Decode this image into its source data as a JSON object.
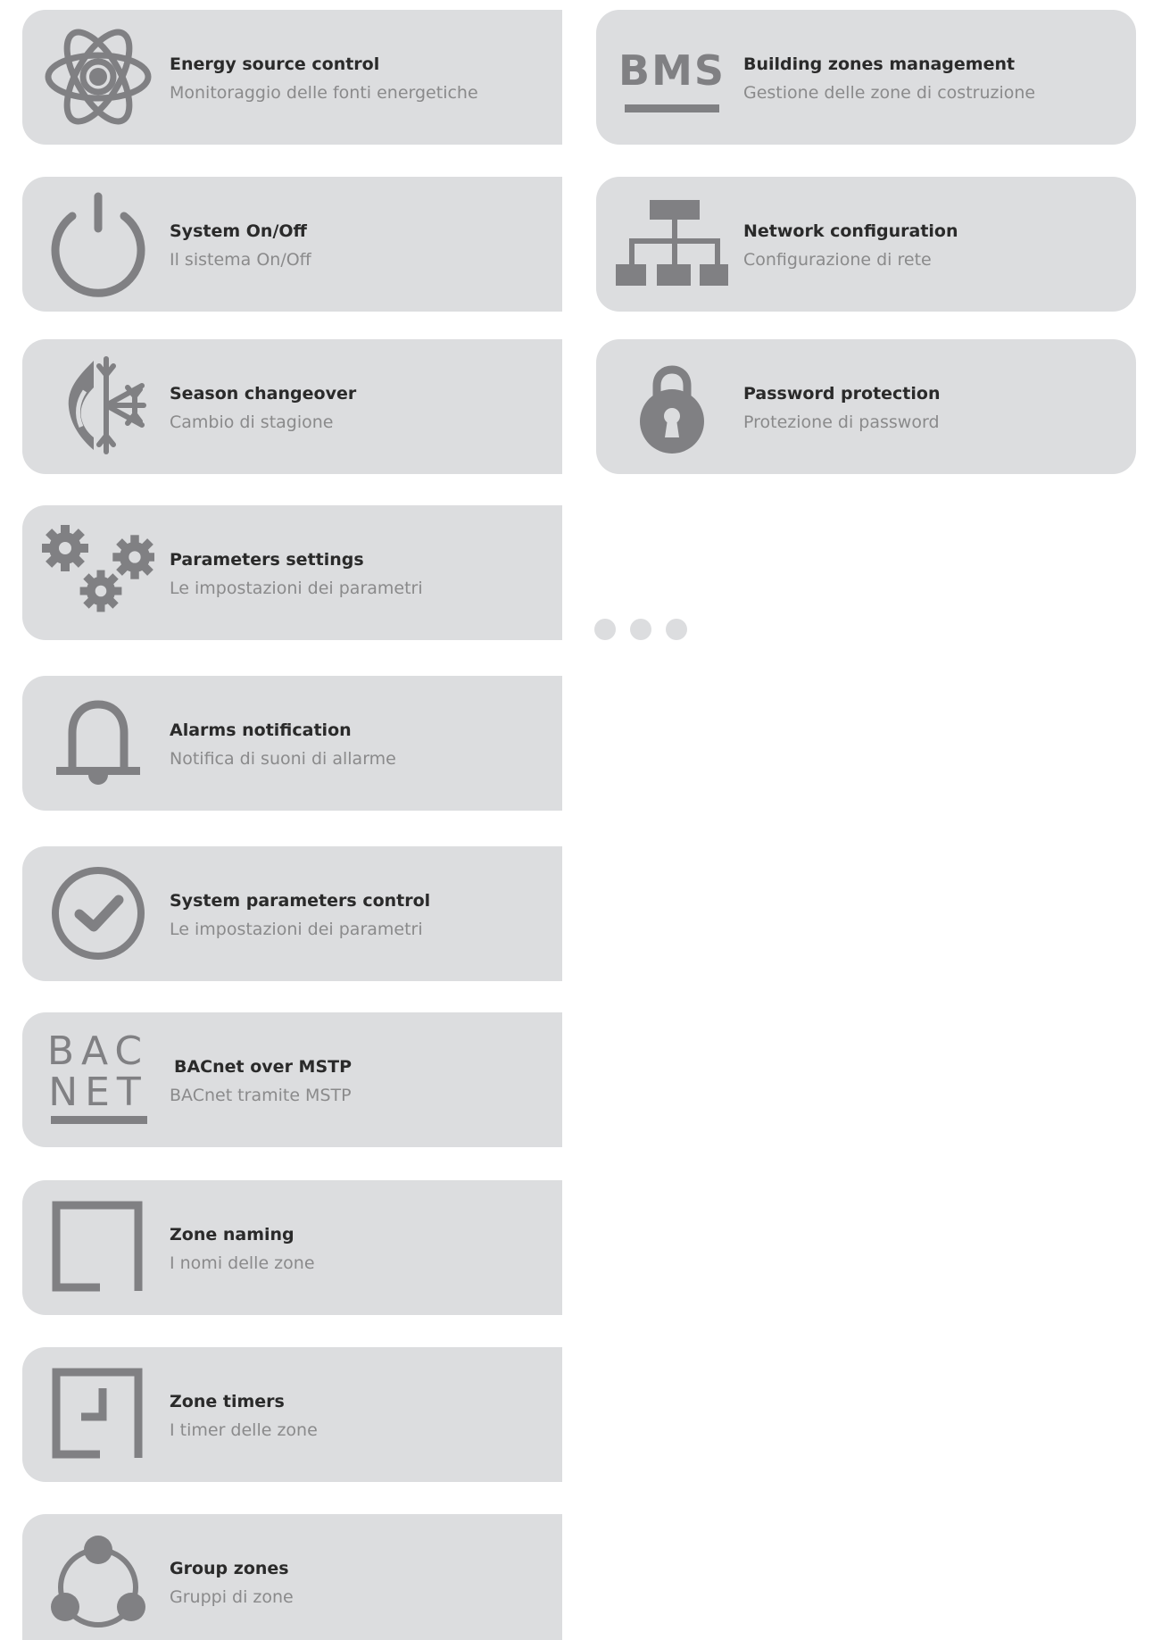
{
  "colors": {
    "card_bg": "#dcdddf",
    "icon": "#808083",
    "title": "#2a2a2a",
    "subtitle": "#8a8a8b"
  },
  "left_cards": [
    {
      "title": "Energy source control",
      "subtitle": "Monitoraggio delle fonti energetiche",
      "icon": "atom-icon"
    },
    {
      "title": "System On/Off",
      "subtitle": "Il sistema On/Off",
      "icon": "power-icon"
    },
    {
      "title": "Season changeover",
      "subtitle": "Cambio di stagione",
      "icon": "flame-snowflake-icon"
    },
    {
      "title": "Parameters settings",
      "subtitle": "Le impostazioni dei parametri",
      "icon": "gears-icon"
    },
    {
      "title": "Alarms notification",
      "subtitle": "Notifica di suoni di allarme",
      "icon": "bell-icon"
    },
    {
      "title": "System parameters control",
      "subtitle": "Le impostazioni dei parametri",
      "icon": "check-circle-icon"
    },
    {
      "title": "BACnet over MSTP",
      "subtitle": "BACnet tramite MSTP",
      "icon": "bacnet-icon",
      "icon_text": [
        "BAC",
        "NET"
      ]
    },
    {
      "title": "Zone naming",
      "subtitle": "I nomi delle zone",
      "icon": "zone-frame-icon"
    },
    {
      "title": "Zone timers",
      "subtitle": "I timer delle zone",
      "icon": "zone-timer-icon"
    },
    {
      "title": "Group zones",
      "subtitle": "Gruppi di zone",
      "icon": "group-nodes-icon"
    }
  ],
  "right_cards": [
    {
      "title": "Building zones management",
      "subtitle": "Gestione delle zone di costruzione",
      "icon": "bms-icon",
      "icon_text": "BMS"
    },
    {
      "title": "Network configuration",
      "subtitle": "Configurazione di rete",
      "icon": "network-icon"
    },
    {
      "title": "Password protection",
      "subtitle": "Protezione di password",
      "icon": "padlock-icon"
    }
  ],
  "pager": {
    "dot_count": 3
  }
}
